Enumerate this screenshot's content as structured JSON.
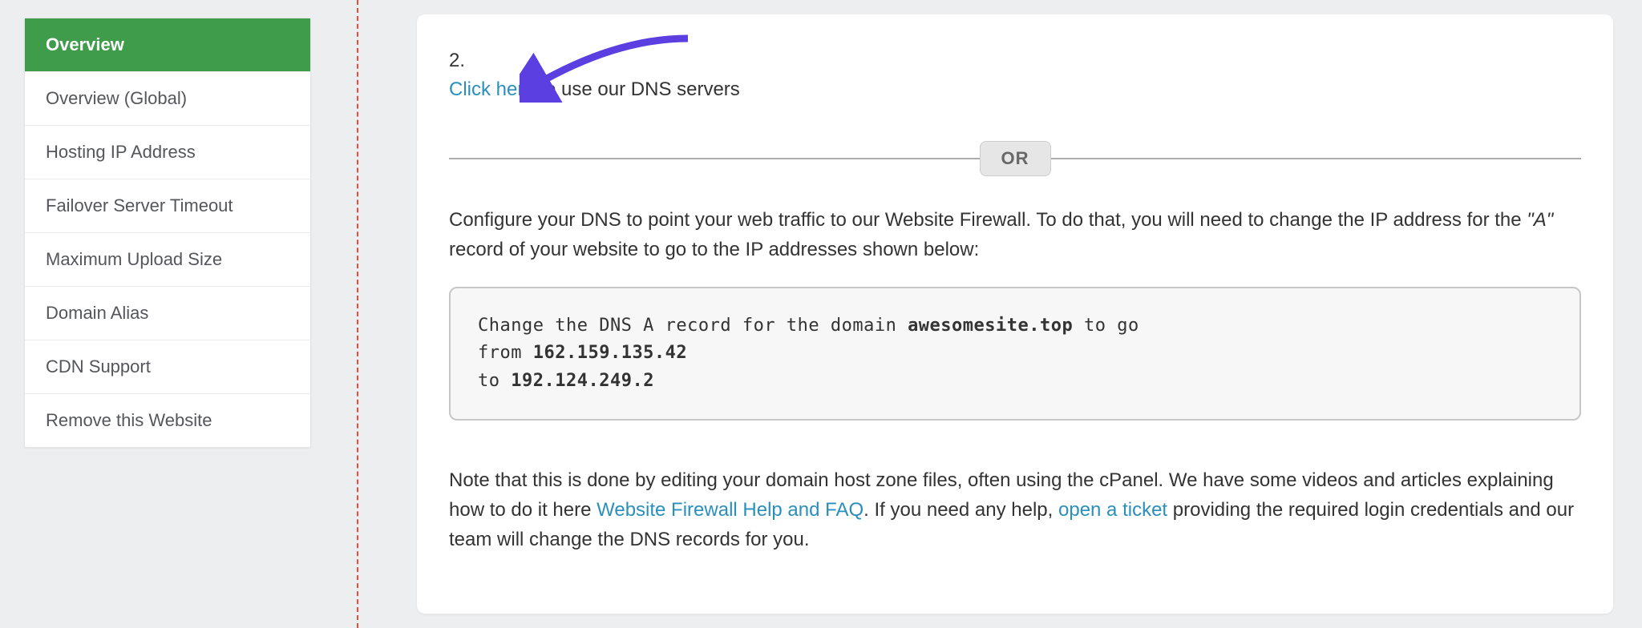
{
  "sidebar": {
    "items": [
      {
        "label": "Overview",
        "active": true
      },
      {
        "label": "Overview (Global)"
      },
      {
        "label": "Hosting IP Address"
      },
      {
        "label": "Failover Server Timeout"
      },
      {
        "label": "Maximum Upload Size"
      },
      {
        "label": "Domain Alias"
      },
      {
        "label": "CDN Support"
      },
      {
        "label": "Remove this Website"
      }
    ]
  },
  "step": {
    "number": "2.",
    "link_text": "Click here",
    "rest": " to use our DNS servers"
  },
  "divider_label": "OR",
  "instructions": {
    "para1_a": "Configure your DNS to point your web traffic to our Website Firewall. To do that, you will need to change the IP address for the ",
    "para1_italic": "\"A\"",
    "para1_b": " record of your website to go to the IP addresses shown below:"
  },
  "dns": {
    "line1_pre": "Change the DNS A record for the domain ",
    "domain": "awesomesite.top",
    "line1_post": " to go",
    "line2_pre": "from ",
    "from_ip": "162.159.135.42",
    "line3_pre": "to ",
    "to_ip": "192.124.249.2"
  },
  "note": {
    "a": "Note that this is done by editing your domain host zone files, often using the cPanel. We have some videos and articles explaining how to do it here ",
    "link1": "Website Firewall Help and FAQ",
    "b": ". If you need any help, ",
    "link2": "open a ticket",
    "c": " providing the required login credentials and our team will change the DNS records for you."
  },
  "colors": {
    "accent_green": "#3f9c4a",
    "link_blue": "#2a8fbd",
    "arrow": "#5b3fe0"
  }
}
